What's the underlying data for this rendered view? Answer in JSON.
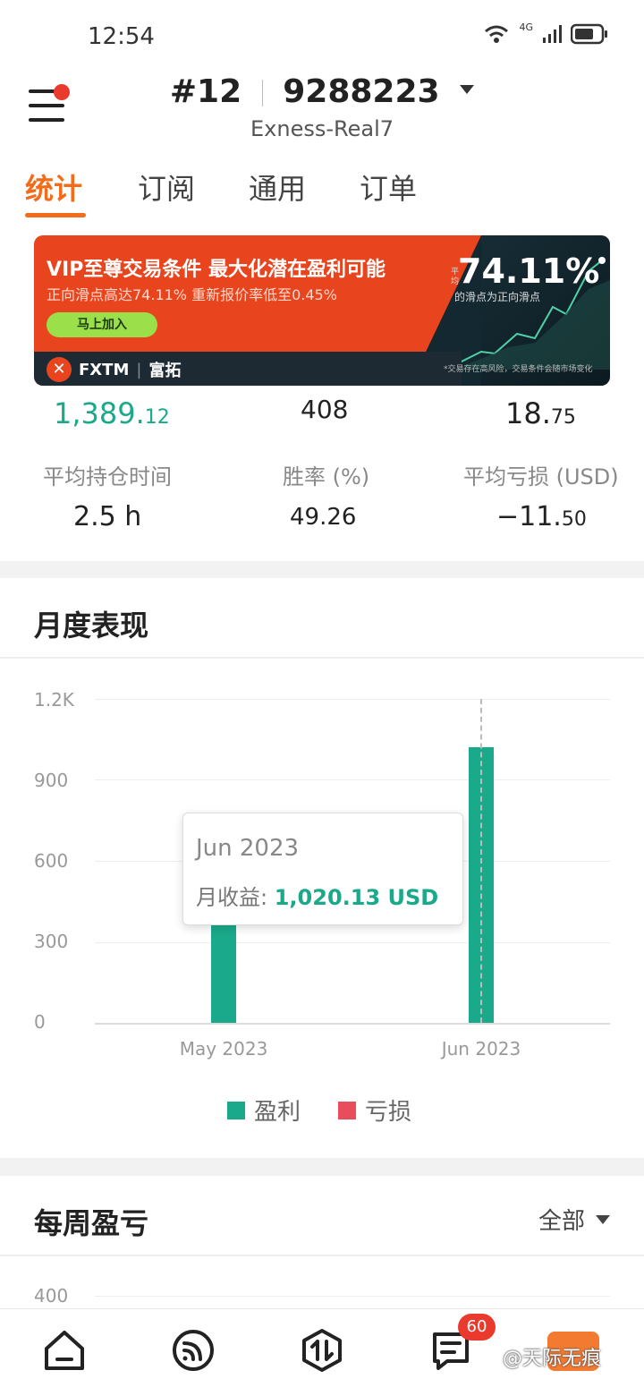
{
  "status_bar": {
    "time": "12:54",
    "network": "4G"
  },
  "header": {
    "account_prefix": "#12",
    "account_number": "9288223",
    "server": "Exness-Real7"
  },
  "tabs": [
    {
      "label": "统计",
      "active": true
    },
    {
      "label": "订阅",
      "active": false
    },
    {
      "label": "通用",
      "active": false
    },
    {
      "label": "订单",
      "active": false
    }
  ],
  "banner": {
    "title": "VIP至尊交易条件 最大化潜在盈利可能",
    "subtitle": "正向滑点高达74.11% 重新报价率低至0.45%",
    "cta": "马上加入",
    "brand": "FXTM",
    "brand_cn": "富拓",
    "stat_prefix": "平均",
    "stat_value": "74.11%",
    "stat_caption": "的滑点为正向滑点",
    "disclaimer": "*交易存在高风险，交易条件会随市场变化"
  },
  "stats": {
    "top_row": [
      {
        "int": "1,389.",
        "dec": "12"
      },
      {
        "int": "408",
        "dec": ""
      },
      {
        "int": "18.",
        "dec": "75"
      }
    ],
    "rows": [
      {
        "label": "平均持仓时间",
        "value_int": "2.5 h",
        "value_dec": ""
      },
      {
        "label": "胜率 (%)",
        "value_int": "49.26",
        "value_dec": ""
      },
      {
        "label": "平均亏损 (USD)",
        "value_int": "−11.",
        "value_dec": "50"
      }
    ]
  },
  "monthly": {
    "title": "月度表现",
    "tooltip": {
      "title": "Jun 2023",
      "label": "月收益:",
      "value": "1,020.13 USD"
    },
    "legend": {
      "profit": "盈利",
      "loss": "亏损"
    }
  },
  "chart_data": {
    "type": "bar",
    "categories": [
      "May 2023",
      "Jun 2023"
    ],
    "series": [
      {
        "name": "盈利",
        "color": "#1aa98a",
        "values": [
          369,
          1020.13
        ]
      },
      {
        "name": "亏损",
        "color": "#e84d5b",
        "values": [
          0,
          0
        ]
      }
    ],
    "yticks": [
      "1.2K",
      "900",
      "600",
      "300",
      "0"
    ],
    "ylim": [
      0,
      1200
    ],
    "grid": true,
    "legend_position": "bottom"
  },
  "weekly": {
    "title": "每周盈亏",
    "filter": "全部",
    "y_first_tick": "400"
  },
  "bottom_nav": {
    "items": [
      "home-icon",
      "signal-feed-icon",
      "trade-icon",
      "messages-icon",
      "profile-icon"
    ],
    "messages_badge": "60"
  },
  "watermark": "@天际无痕",
  "colors": {
    "accent": "#f26c1b",
    "profit": "#1aa98a",
    "loss": "#e84d5b"
  }
}
